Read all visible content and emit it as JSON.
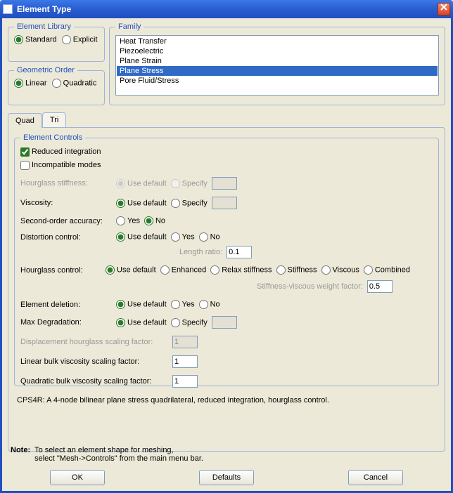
{
  "window": {
    "title": "Element Type"
  },
  "elementLibrary": {
    "legend": "Element Library",
    "options": {
      "standard": "Standard",
      "explicit": "Explicit"
    },
    "selected": "standard"
  },
  "geometricOrder": {
    "legend": "Geometric Order",
    "options": {
      "linear": "Linear",
      "quadratic": "Quadratic"
    },
    "selected": "linear"
  },
  "family": {
    "legend": "Family",
    "items": [
      "Heat Transfer",
      "Piezoelectric",
      "Plane Strain",
      "Plane Stress",
      "Pore Fluid/Stress"
    ],
    "selected": "Plane Stress"
  },
  "tabs": {
    "quad": "Quad",
    "tri": "Tri",
    "active": "quad"
  },
  "controls": {
    "legend": "Element Controls",
    "reducedIntegration": {
      "label": "Reduced integration",
      "checked": true
    },
    "incompatibleModes": {
      "label": "Incompatible modes",
      "checked": false
    },
    "hourglassStiffness": {
      "label": "Hourglass stiffness:",
      "useDefault": "Use default",
      "specify": "Specify",
      "selected": "useDefault",
      "value": "",
      "enabled": false
    },
    "viscosity": {
      "label": "Viscosity:",
      "useDefault": "Use default",
      "specify": "Specify",
      "selected": "useDefault",
      "value": ""
    },
    "secondOrderAccuracy": {
      "label": "Second-order accuracy:",
      "yes": "Yes",
      "no": "No",
      "selected": "no"
    },
    "distortionControl": {
      "label": "Distortion control:",
      "useDefault": "Use default",
      "yes": "Yes",
      "no": "No",
      "selected": "useDefault",
      "lengthRatioLabel": "Length ratio:",
      "lengthRatio": "0.1"
    },
    "hourglassControl": {
      "label": "Hourglass control:",
      "options": {
        "useDefault": "Use default",
        "enhanced": "Enhanced",
        "relax": "Relax stiffness",
        "stiffness": "Stiffness",
        "viscous": "Viscous",
        "combined": "Combined"
      },
      "selected": "useDefault",
      "weightLabel": "Stiffness-viscous weight factor:",
      "weight": "0.5"
    },
    "elementDeletion": {
      "label": "Element deletion:",
      "useDefault": "Use default",
      "yes": "Yes",
      "no": "No",
      "selected": "useDefault"
    },
    "maxDegradation": {
      "label": "Max Degradation:",
      "useDefault": "Use default",
      "specify": "Specify",
      "selected": "useDefault",
      "value": ""
    },
    "dispHourglass": {
      "label": "Displacement hourglass scaling factor:",
      "value": "1",
      "enabled": false
    },
    "linearBulk": {
      "label": "Linear bulk viscosity scaling factor:",
      "value": "1"
    },
    "quadBulk": {
      "label": "Quadratic bulk viscosity scaling factor:",
      "value": "1"
    }
  },
  "description": "CPS4R:  A 4-node bilinear plane stress quadrilateral, reduced integration, hourglass control.",
  "note": {
    "label": "Note:",
    "line1": "To select an element shape for meshing,",
    "line2": "select \"Mesh->Controls\" from the main menu bar."
  },
  "buttons": {
    "ok": "OK",
    "defaults": "Defaults",
    "cancel": "Cancel"
  }
}
